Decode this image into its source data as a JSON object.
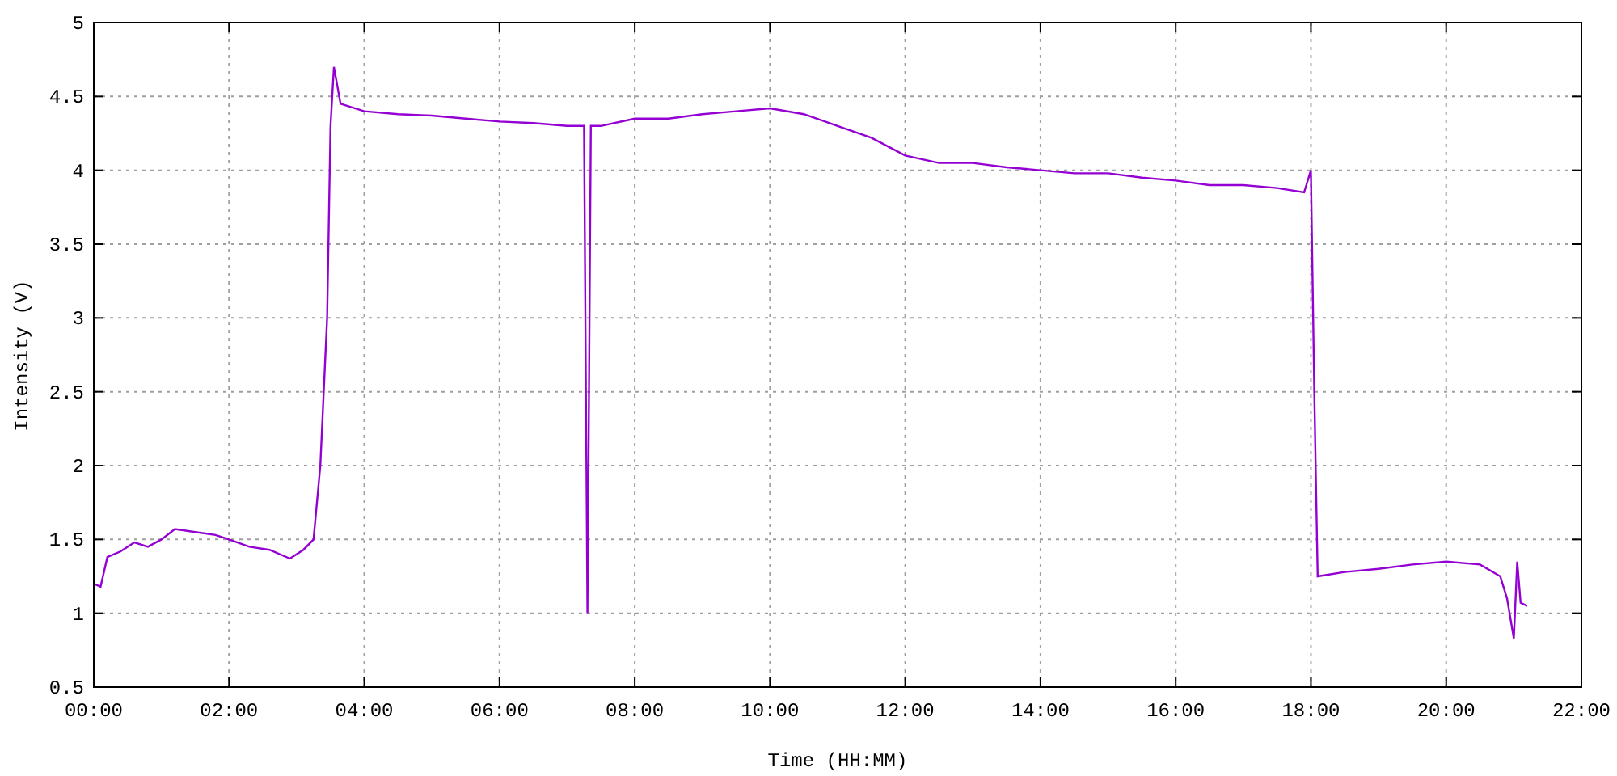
{
  "chart": {
    "chart_data": {
      "type": "line",
      "grid": true,
      "xlabel": "Time (HH:MM)",
      "ylabel": "Intensity (V)",
      "x": [
        0,
        0.1,
        0.2,
        0.4,
        0.6,
        0.8,
        1.0,
        1.2,
        1.5,
        1.8,
        2.0,
        2.3,
        2.6,
        2.9,
        3.1,
        3.25,
        3.35,
        3.45,
        3.5,
        3.55,
        3.65,
        4.0,
        4.5,
        5.0,
        5.5,
        6.0,
        6.5,
        7.0,
        7.25,
        7.3,
        7.35,
        7.5,
        8.0,
        8.5,
        9.0,
        9.5,
        10.0,
        10.5,
        11.0,
        11.5,
        12.0,
        12.5,
        13.0,
        13.5,
        14.0,
        14.5,
        15.0,
        15.5,
        16.0,
        16.5,
        17.0,
        17.5,
        17.9,
        18.0,
        18.05,
        18.1,
        18.5,
        19.0,
        19.5,
        20.0,
        20.5,
        20.8,
        20.9,
        21.0,
        21.05,
        21.1,
        21.2
      ],
      "series": [
        {
          "color": "#9400d3",
          "values": [
            1.2,
            1.18,
            1.38,
            1.42,
            1.48,
            1.45,
            1.5,
            1.57,
            1.55,
            1.53,
            1.5,
            1.45,
            1.43,
            1.37,
            1.43,
            1.5,
            2.0,
            3.0,
            4.3,
            4.7,
            4.45,
            4.4,
            4.38,
            4.37,
            4.35,
            4.33,
            4.32,
            4.3,
            4.3,
            1.0,
            4.3,
            4.3,
            4.35,
            4.35,
            4.38,
            4.4,
            4.42,
            4.38,
            4.3,
            4.22,
            4.1,
            4.05,
            4.05,
            4.02,
            4.0,
            3.98,
            3.98,
            3.95,
            3.93,
            3.9,
            3.9,
            3.88,
            3.85,
            4.0,
            2.5,
            1.25,
            1.28,
            1.3,
            1.33,
            1.35,
            1.33,
            1.25,
            1.1,
            0.83,
            1.35,
            1.07,
            1.05
          ]
        }
      ],
      "xlim": [
        0,
        22
      ],
      "ylim": [
        0.5,
        5
      ],
      "xticks": [
        {
          "value": 0,
          "label": "00:00"
        },
        {
          "value": 2,
          "label": "02:00"
        },
        {
          "value": 4,
          "label": "04:00"
        },
        {
          "value": 6,
          "label": "06:00"
        },
        {
          "value": 8,
          "label": "08:00"
        },
        {
          "value": 10,
          "label": "10:00"
        },
        {
          "value": 12,
          "label": "12:00"
        },
        {
          "value": 14,
          "label": "14:00"
        },
        {
          "value": 16,
          "label": "16:00"
        },
        {
          "value": 18,
          "label": "18:00"
        },
        {
          "value": 20,
          "label": "20:00"
        },
        {
          "value": 22,
          "label": "22:00"
        }
      ],
      "yticks": [
        {
          "value": 0.5,
          "label": "0.5"
        },
        {
          "value": 1,
          "label": "1"
        },
        {
          "value": 1.5,
          "label": "1.5"
        },
        {
          "value": 2,
          "label": "2"
        },
        {
          "value": 2.5,
          "label": "2.5"
        },
        {
          "value": 3,
          "label": "3"
        },
        {
          "value": 3.5,
          "label": "3.5"
        },
        {
          "value": 4,
          "label": "4"
        },
        {
          "value": 4.5,
          "label": "4.5"
        },
        {
          "value": 5,
          "label": "5"
        }
      ]
    }
  }
}
